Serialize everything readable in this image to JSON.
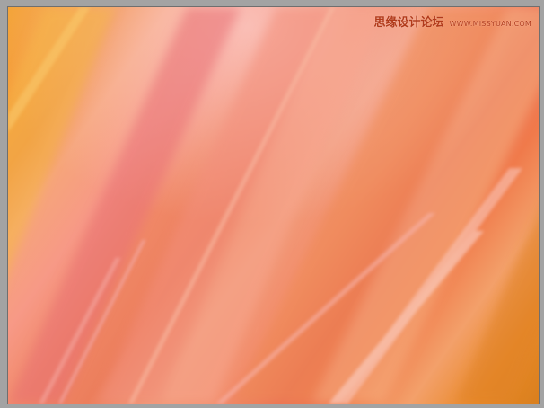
{
  "watermark": {
    "site_name_cn": "思缘设计论坛",
    "site_url": "WWW.MISSYUAN.COM"
  },
  "image": {
    "subject": "diagonal-motion-blur-streaks",
    "palette": [
      "#f2a12d",
      "#f79986",
      "#ec7e5c",
      "#ea6f55",
      "#d97f1d"
    ]
  }
}
